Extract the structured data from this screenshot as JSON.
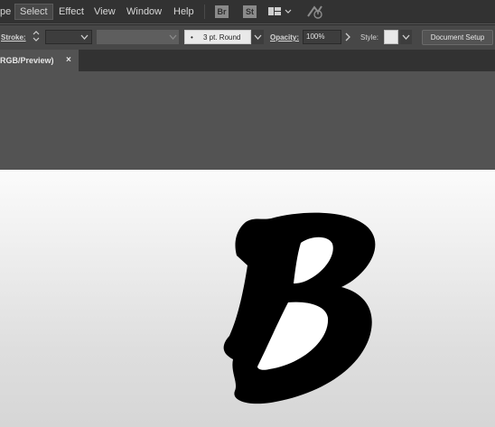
{
  "menubar": {
    "items": [
      "pe",
      "Select",
      "Effect",
      "View",
      "Window",
      "Help"
    ],
    "app_icons": [
      "Br",
      "St"
    ]
  },
  "control": {
    "stroke_label": "Stroke:",
    "brush_label": "3 pt. Round",
    "opacity_label": "Opacity:",
    "opacity_value": "100%",
    "style_label": "Style:",
    "doc_setup": "Document Setup"
  },
  "tab": {
    "label": "RGB/Preview)",
    "close": "×"
  },
  "canvas": {
    "glyph_fill": "#000000",
    "glyph_counter": "#ffffff"
  }
}
